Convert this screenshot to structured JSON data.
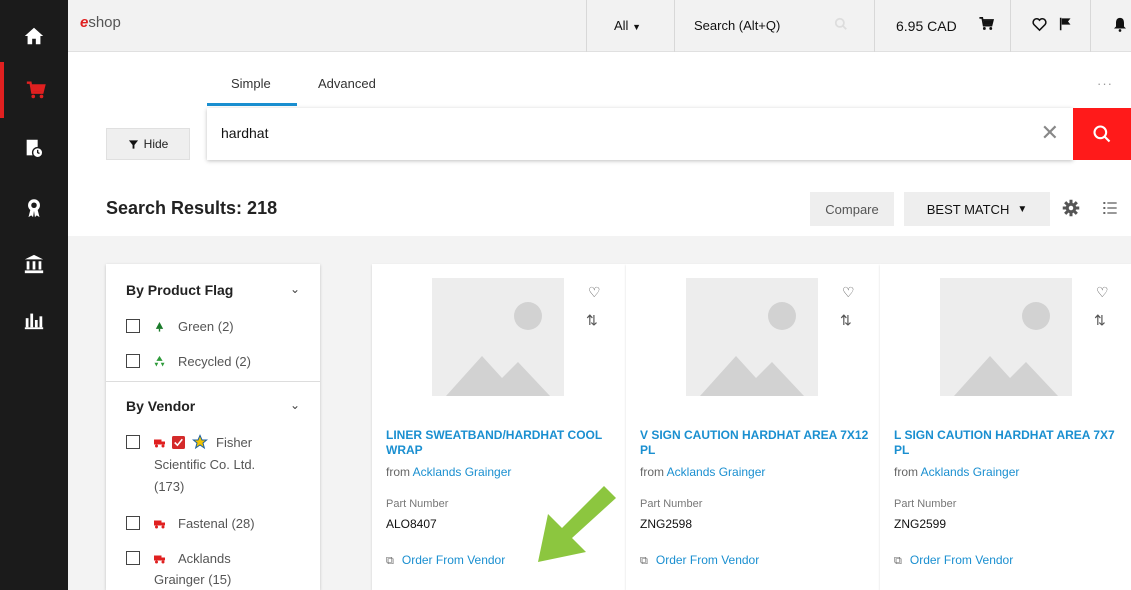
{
  "topbar": {
    "logo_e": "e",
    "logo_text": "shop",
    "scope": "All",
    "search_placeholder": "Search (Alt+Q)",
    "cart_total": "6.95 CAD"
  },
  "search": {
    "tabs": [
      "Simple",
      "Advanced"
    ],
    "value": "hardhat",
    "more": "···"
  },
  "toolbar": {
    "hide_label": "Hide",
    "results_title": "Search Results: 218",
    "compare_label": "Compare",
    "sort_label": "BEST MATCH"
  },
  "filters": {
    "product_flag": {
      "title": "By Product Flag",
      "items": [
        {
          "label": "Green (2)",
          "icon": "tree-icon"
        },
        {
          "label": "Recycled (2)",
          "icon": "recycle-icon"
        }
      ]
    },
    "vendor": {
      "title": "By Vendor",
      "items": [
        {
          "line1": "Fisher",
          "line2": "Scientific Co. Ltd.",
          "line3": "(173)"
        },
        {
          "line1": "Fastenal (28)"
        },
        {
          "line1": "Acklands",
          "line2": "Grainger (15)"
        }
      ]
    }
  },
  "products": [
    {
      "title": "LINER SWEATBAND/HARDHAT COOL WRAP",
      "from_prefix": "from",
      "vendor": "Acklands Grainger",
      "pn_label": "Part Number",
      "part_number": "ALO8407",
      "order_label": "Order From Vendor"
    },
    {
      "title": "V SIGN CAUTION HARDHAT AREA 7X12 PL",
      "from_prefix": "from",
      "vendor": "Acklands Grainger",
      "pn_label": "Part Number",
      "part_number": "ZNG2598",
      "order_label": "Order From Vendor"
    },
    {
      "title": "L SIGN CAUTION HARDHAT AREA 7X7 PL",
      "from_prefix": "from",
      "vendor": "Acklands Grainger",
      "pn_label": "Part Number",
      "part_number": "ZNG2599",
      "order_label": "Order From Vendor"
    }
  ],
  "colors": {
    "accent": "#1a8fd0",
    "brand_red": "#e02020",
    "arrow": "#8cc63f"
  }
}
